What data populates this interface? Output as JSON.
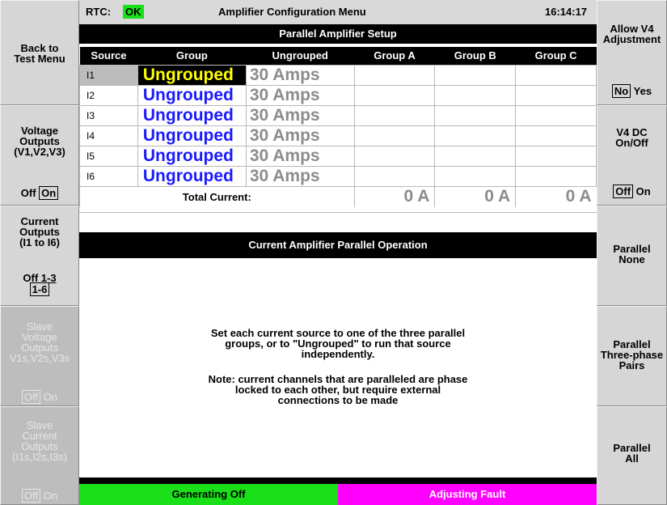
{
  "header": {
    "rtc_label": "RTC:",
    "rtc_status": "OK",
    "title": "Amplifier Configuration Menu",
    "time": "16:14:17"
  },
  "section_title": "Parallel Amplifier Setup",
  "table": {
    "columns": [
      "Source",
      "Group",
      "Ungrouped",
      "Group A",
      "Group B",
      "Group C"
    ],
    "rows": [
      {
        "source": "I1",
        "group": "Ungrouped",
        "ungrouped": "30 Amps"
      },
      {
        "source": "I2",
        "group": "Ungrouped",
        "ungrouped": "30 Amps"
      },
      {
        "source": "I3",
        "group": "Ungrouped",
        "ungrouped": "30 Amps"
      },
      {
        "source": "I4",
        "group": "Ungrouped",
        "ungrouped": "30 Amps"
      },
      {
        "source": "I5",
        "group": "Ungrouped",
        "ungrouped": "30 Amps"
      },
      {
        "source": "I6",
        "group": "Ungrouped",
        "ungrouped": "30 Amps"
      }
    ],
    "total_label": "Total Current:",
    "totals": {
      "a": "0 A",
      "b": "0 A",
      "c": "0 A"
    }
  },
  "panel_title": "Current Amplifier Parallel Operation",
  "message1": "Set each current source to one of the three parallel\ngroups, or to \"Ungrouped\" to run that source\nindependently.",
  "message2": "Note: current channels that are paralleled are phase\nlocked to each other, but require external\nconnections to be made",
  "left_buttons": {
    "back": "Back to\nTest Menu",
    "voltage": {
      "label": "Voltage\nOutputs\n(V1,V2,V3)",
      "off": "Off",
      "on": "On"
    },
    "current": {
      "label": "Current\nOutputs\n(I1 to I6)",
      "off": "Off",
      "opt2": "1-3",
      "opt3": "1-6"
    },
    "slave_voltage": {
      "label": "Slave\nVoltage\nOutputs\nV1s,V2s,V3s",
      "off": "Off",
      "on": "On"
    },
    "slave_current": {
      "label": "Slave\nCurrent\nOutputs\n(I1s,I2s,I3s)",
      "off": "Off",
      "on": "On"
    }
  },
  "right_buttons": {
    "allow_v4": {
      "label": "Allow V4\nAdjustment",
      "no": "No",
      "yes": "Yes"
    },
    "v4dc": {
      "label": "V4 DC\nOn/Off",
      "off": "Off",
      "on": "On"
    },
    "parallel_none": "Parallel\nNone",
    "parallel_three": "Parallel\nThree-phase\nPairs",
    "parallel_all": "Parallel\nAll"
  },
  "status": {
    "left": "Generating Off",
    "right": "Adjusting Fault"
  },
  "colors": {
    "ok": "#19e019",
    "status_left": "#19e019",
    "status_right": "#ff00ff",
    "group_text": "#1a1aff",
    "selected_group_text": "#ffff00"
  }
}
